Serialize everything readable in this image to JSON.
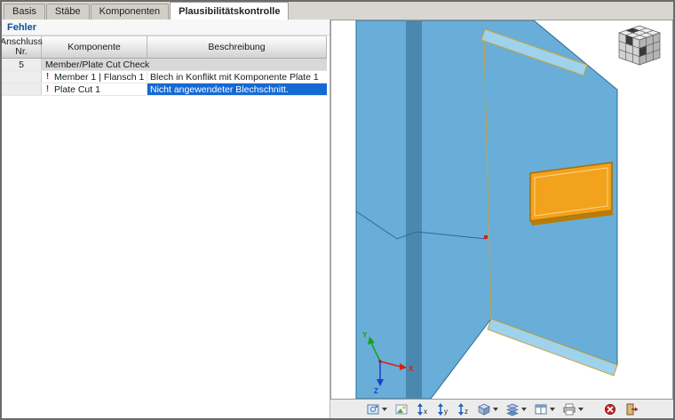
{
  "tabs": {
    "items": [
      {
        "label": "Basis"
      },
      {
        "label": "Stäbe"
      },
      {
        "label": "Komponenten"
      },
      {
        "label": "Plausibilitätskontrolle"
      }
    ],
    "active_index": 3
  },
  "error_panel": {
    "title": "Fehler",
    "headers": {
      "anschluss": "Anschluss\nNr.",
      "komponente": "Komponente",
      "beschreibung": "Beschreibung"
    },
    "group_row": {
      "nr": "5",
      "label": "Member/Plate Cut Check"
    },
    "rows": [
      {
        "icon": "error",
        "component": "Member 1 | Flansch 1",
        "description": "Blech in Konflikt mit Komponente Plate 1",
        "selected": false
      },
      {
        "icon": "error",
        "component": "Plate Cut 1",
        "description": "Nicht angewendeter Blechschnitt.",
        "selected": true
      }
    ]
  },
  "icons": {
    "error_glyph": "!"
  },
  "viewport": {
    "axes": {
      "x": "X",
      "y": "Y",
      "z": "Z"
    },
    "colors": {
      "plate": "#68aed9",
      "plate_dark": "#4a88b0",
      "plate_light": "#9fd2ec",
      "highlight": "#f2a21d",
      "highlight_inner": "#ffd48a",
      "highlight_edge": "#b97c08",
      "edge_gold": "#c9a23c",
      "selection_blue": "#1569d4"
    }
  },
  "toolbar": {
    "items": [
      {
        "name": "print-graphic",
        "dropdown": true
      },
      {
        "name": "background-image",
        "dropdown": false
      },
      {
        "name": "view-x",
        "dropdown": false,
        "letter": "x"
      },
      {
        "name": "view-y",
        "dropdown": false,
        "letter": "y"
      },
      {
        "name": "view-z",
        "dropdown": false,
        "letter": "z"
      },
      {
        "name": "isometric-view",
        "dropdown": true
      },
      {
        "name": "layers",
        "dropdown": true
      },
      {
        "name": "work-window",
        "dropdown": true
      },
      {
        "name": "print",
        "dropdown": true
      },
      {
        "name": "deactivate-view",
        "dropdown": false
      },
      {
        "name": "close-view",
        "dropdown": false
      }
    ]
  }
}
